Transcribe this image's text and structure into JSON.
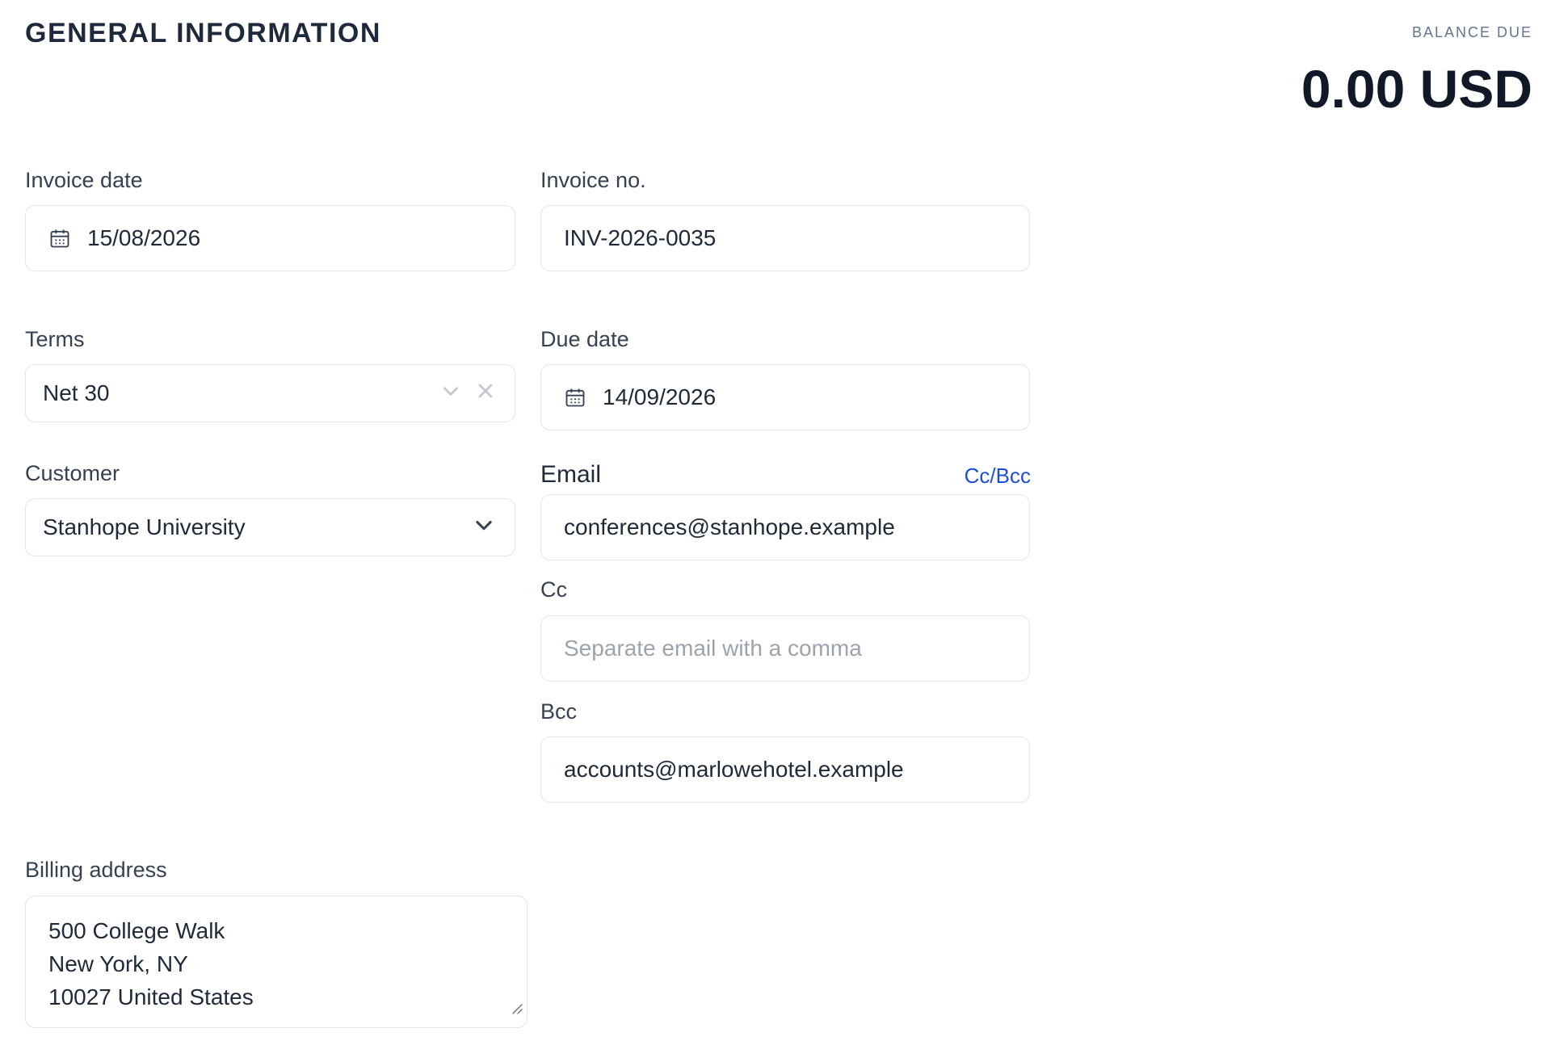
{
  "header": {
    "section_title": "GENERAL INFORMATION",
    "balance_label": "BALANCE DUE",
    "balance_amount": "0.00 USD"
  },
  "form": {
    "invoice_date": {
      "label": "Invoice date",
      "value": "15/08/2026",
      "icon": "calendar-icon"
    },
    "invoice_no": {
      "label": "Invoice no.",
      "value": "INV-2026-0035"
    },
    "terms": {
      "label": "Terms",
      "value": "Net 30",
      "icons": [
        "chevron-down-icon",
        "clear-icon"
      ]
    },
    "due_date": {
      "label": "Due date",
      "value": "14/09/2026",
      "icon": "calendar-icon"
    },
    "customer": {
      "label": "Customer",
      "value": "Stanhope University",
      "icon": "chevron-down-icon"
    },
    "email": {
      "label": "Email",
      "value": "conferences@stanhope.example",
      "cc_bcc_link": "Cc/Bcc"
    },
    "cc": {
      "label": "Cc",
      "placeholder": "Separate email with a comma",
      "value": ""
    },
    "bcc": {
      "label": "Bcc",
      "value": "accounts@marlowehotel.example"
    },
    "billing_address": {
      "label": "Billing address",
      "lines": [
        "500 College Walk",
        "New York, NY",
        "10027 United States"
      ]
    }
  },
  "colors": {
    "border": "#e2e6ea",
    "link": "#1d4ed8",
    "text_primary": "#1f2937",
    "text_muted": "#64748b",
    "placeholder": "#9ca3af"
  }
}
